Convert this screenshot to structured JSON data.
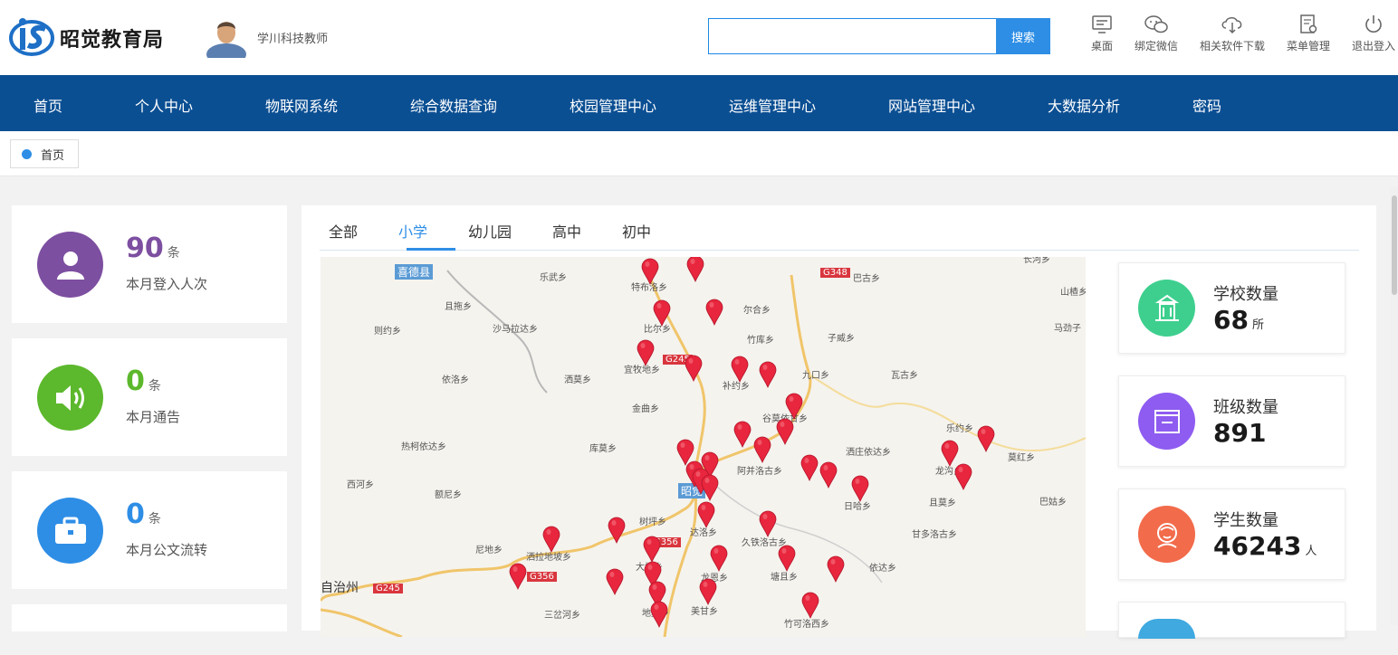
{
  "brand": {
    "name": "昭觉教育局",
    "logo_text": "iS"
  },
  "user": {
    "name": "学川科技教师"
  },
  "search": {
    "placeholder": "",
    "button": "搜索"
  },
  "tools": [
    {
      "label": "桌面",
      "icon": "desktop-icon"
    },
    {
      "label": "绑定微信",
      "icon": "wechat-icon"
    },
    {
      "label": "相关软件下载",
      "icon": "cloud-download-icon"
    },
    {
      "label": "菜单管理",
      "icon": "menu-settings-icon"
    },
    {
      "label": "退出登入",
      "icon": "power-icon"
    }
  ],
  "nav": [
    "首页",
    "个人中心",
    "物联网系统",
    "综合数据查询",
    "校园管理中心",
    "运维管理中心",
    "网站管理中心",
    "大数据分析",
    "密码"
  ],
  "breadcrumb": {
    "label": "首页"
  },
  "stats": [
    {
      "value": "90",
      "unit": "条",
      "label": "本月登入人次",
      "color": "#7d4fa0",
      "icon": "user-icon"
    },
    {
      "value": "0",
      "unit": "条",
      "label": "本月通告",
      "color": "#5cb82c",
      "icon": "speaker-icon"
    },
    {
      "value": "0",
      "unit": "条",
      "label": "本月公文流转",
      "color": "#2e8ee6",
      "icon": "briefcase-icon"
    }
  ],
  "tabs": [
    "全部",
    "小学",
    "幼儿园",
    "高中",
    "初中"
  ],
  "active_tab": "小学",
  "map": {
    "labels": [
      "喜德县",
      "且拖乡",
      "乐武乡",
      "特布洛乡",
      "巴古乡",
      "长河乡",
      "尔合乡",
      "山楂乡",
      "则约乡",
      "沙马拉达乡",
      "比尔乡",
      "竹库乡",
      "子威乡",
      "马劲子",
      "依洛乡",
      "洒莫乡",
      "宜牧地乡",
      "补约乡",
      "九口乡",
      "瓦古乡",
      "金曲乡",
      "谷莫依甘乡",
      "乐约乡",
      "热柯依达乡",
      "库莫乡",
      "洒庄依达乡",
      "莫红乡",
      "阿并洛古乡",
      "龙沟乡",
      "西河乡",
      "额尼乡",
      "昭觉",
      "日哈乡",
      "且莫乡",
      "巴姑乡",
      "树坪乡",
      "达洛乡",
      "甘多洛古乡",
      "尼地乡",
      "洒拉地坡乡",
      "久铁洛古乡",
      "大坝乡",
      "龙恩乡",
      "塘且乡",
      "依达乡",
      "自治州",
      "三岔河乡",
      "美甘乡",
      "地莫乡",
      "竹可洛西乡"
    ],
    "roads": [
      "G348",
      "G245",
      "G356",
      "G245",
      "G356"
    ]
  },
  "kpis": [
    {
      "title": "学校数量",
      "value": "68",
      "unit": "所",
      "color": "#3ecf8e",
      "icon": "school-icon"
    },
    {
      "title": "班级数量",
      "value": "891",
      "unit": "",
      "color": "#8e5cf0",
      "icon": "class-board-icon"
    },
    {
      "title": "学生数量",
      "value": "46243",
      "unit": "人",
      "color": "#f26b4b",
      "icon": "student-icon"
    }
  ]
}
